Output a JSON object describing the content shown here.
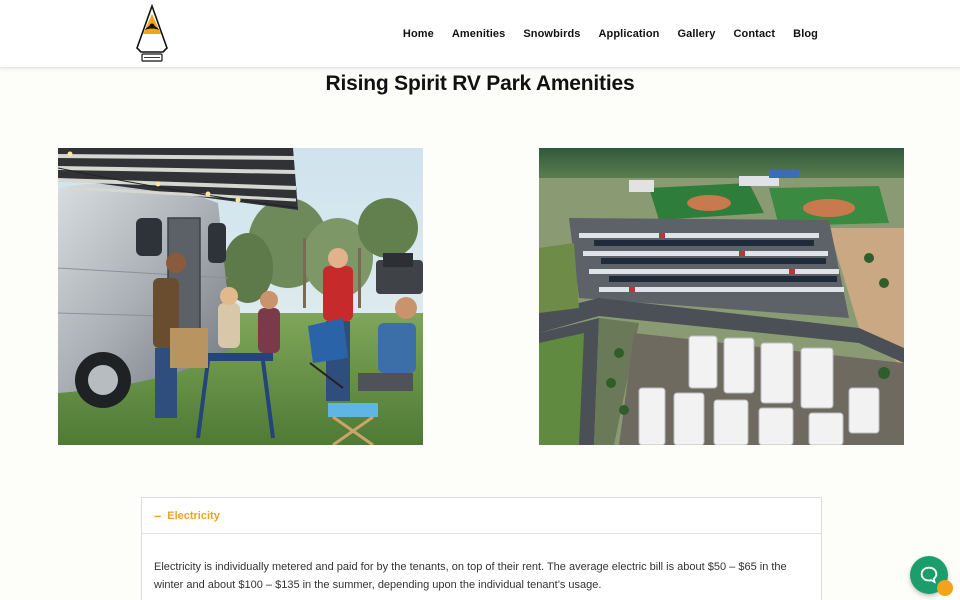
{
  "site": {
    "logo_alt": "Rising Spirit RV Park logo",
    "logo_text": "Rising Spirit"
  },
  "nav": {
    "items": [
      {
        "label": "Home"
      },
      {
        "label": "Amenities"
      },
      {
        "label": "Snowbirds"
      },
      {
        "label": "Application"
      },
      {
        "label": "Gallery"
      },
      {
        "label": "Contact"
      },
      {
        "label": "Blog"
      }
    ]
  },
  "page": {
    "title": "Rising Spirit RV Park Amenities"
  },
  "photos": [
    {
      "alt": "Friends gathered around an Airstream camper with camping chairs"
    },
    {
      "alt": "Aerial view of RV park and parking lot near ballfields"
    }
  ],
  "accordion": {
    "toggle_symbol": "–",
    "title": "Electricity",
    "body": "Electricity is individually metered and paid for by the tenants, on top of their rent.  The average electric bill is about $50 – $65 in the winter and about $100 – $135 in the summer, depending upon the individual tenant’s usage."
  },
  "chat": {
    "icon": "chat-bubble-icon"
  },
  "colors": {
    "accent": "#f2a31a",
    "chat": "#1b9e6b"
  }
}
